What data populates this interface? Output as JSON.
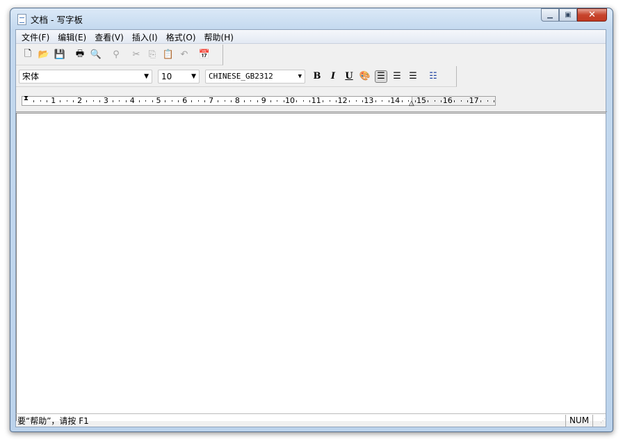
{
  "window": {
    "title": "文档 - 写字板"
  },
  "menu": [
    "文件(F)",
    "编辑(E)",
    "查看(V)",
    "插入(I)",
    "格式(O)",
    "帮助(H)"
  ],
  "format": {
    "font": "宋体",
    "size": "10",
    "script": "CHINESE_GB2312",
    "bold": "B",
    "italic": "I",
    "underline": "U"
  },
  "ruler": {
    "labels": [
      "1",
      "2",
      "3",
      "4",
      "5",
      "6",
      "7",
      "8",
      "9",
      "10",
      "11",
      "12",
      "13",
      "14",
      "15",
      "16",
      "17"
    ]
  },
  "status": {
    "help": "要“帮助”，请按 F1",
    "num": "NUM"
  }
}
